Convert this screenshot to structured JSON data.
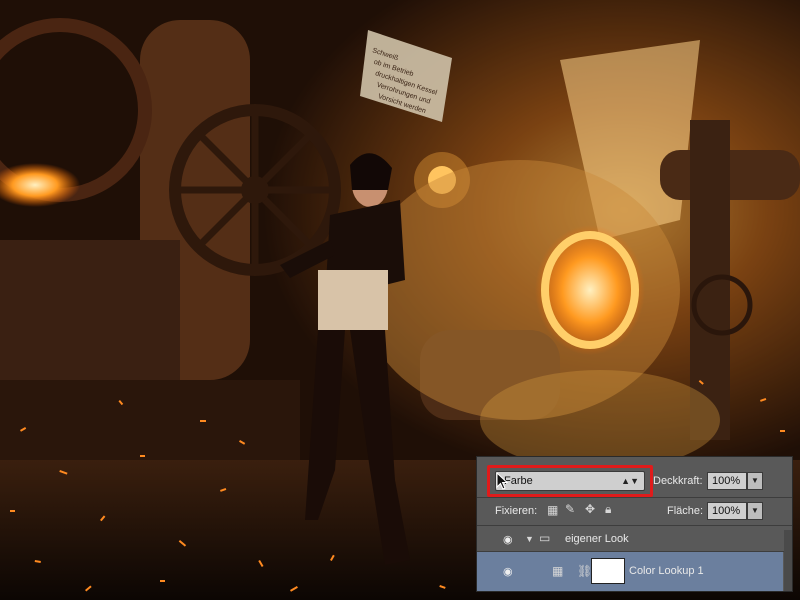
{
  "panel": {
    "blend_mode": "Farbe",
    "opacity_label": "Deckkraft:",
    "opacity_value": "100%",
    "lock_label": "Fixieren:",
    "fill_label": "Fläche:",
    "fill_value": "100%"
  },
  "layers": [
    {
      "name": "eigener Look",
      "type": "group"
    },
    {
      "name": "Color Lookup 1",
      "type": "adjustment"
    }
  ],
  "scene": {
    "sign_lines": [
      "Schweiß",
      "ob im Betrieb",
      "druckhaltigen Kessel",
      "Verrohrungen und",
      "Vorsicht werden"
    ]
  },
  "colors": {
    "fire": "#ffb23a",
    "highlight_box": "#e01b1b",
    "selected_layer": "#6b7f9e"
  }
}
